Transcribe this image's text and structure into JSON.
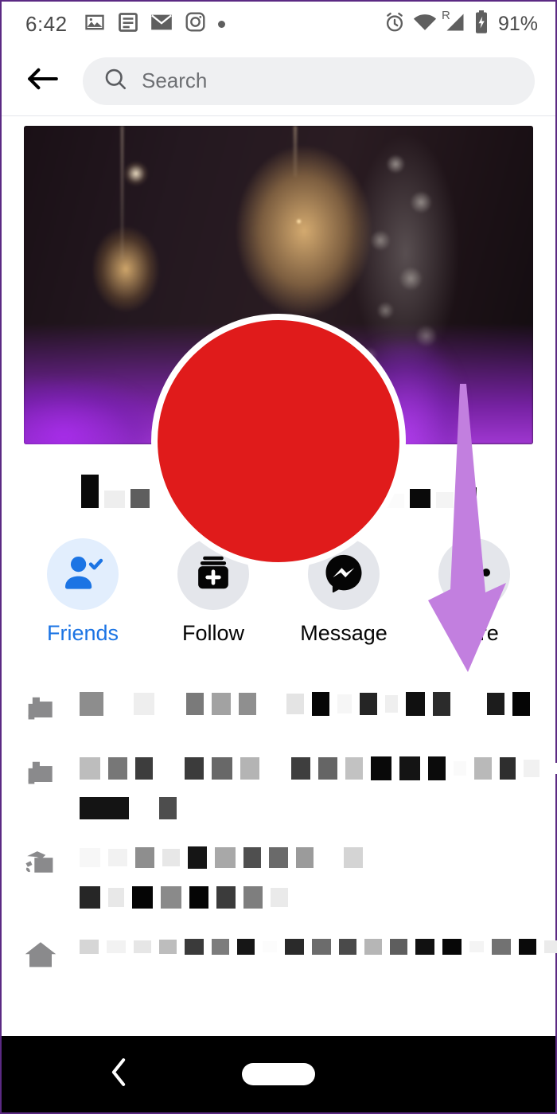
{
  "status_bar": {
    "time": "6:42",
    "left_icons": [
      "photo-icon",
      "news-icon",
      "mail-icon",
      "instagram-icon",
      "dot-icon"
    ],
    "right_icons": [
      "alarm-icon",
      "wifi-icon",
      "cellular-roaming-icon",
      "battery-charging-icon"
    ],
    "roaming_label": "R",
    "battery_percent": "91%"
  },
  "header": {
    "back_icon": "arrow-left-icon",
    "search_icon": "search-icon",
    "search_placeholder": "Search",
    "search_value": ""
  },
  "profile": {
    "cover_photo_alt": "fairy-lights-bokeh-cover-photo",
    "avatar_alt": "redacted-profile-photo",
    "avatar_color": "#e01b1b",
    "name_redacted": true,
    "name_blocks": [
      {
        "w": 22,
        "h": 42,
        "c": "#0a0a0a"
      },
      {
        "w": 26,
        "h": 22,
        "c": "#eeeeee"
      },
      {
        "w": 24,
        "h": 24,
        "c": "#5e5e5e"
      },
      {
        "w": 18,
        "h": 16,
        "c": "#ffffff"
      },
      {
        "w": 24,
        "h": 24,
        "c": "#151515"
      },
      {
        "w": 24,
        "h": 22,
        "c": "#f7f7f7"
      },
      {
        "w": 14,
        "h": 14,
        "c": "#ffffff"
      },
      {
        "w": 26,
        "h": 42,
        "c": "#1c1c1c"
      },
      {
        "w": 16,
        "h": 16,
        "c": "#ffffff"
      },
      {
        "w": 52,
        "h": 42,
        "c": "#080808"
      },
      {
        "w": 20,
        "h": 16,
        "c": "#ffffff"
      },
      {
        "w": 26,
        "h": 24,
        "c": "#8b8b8b"
      },
      {
        "w": 30,
        "h": 18,
        "c": "#fbfbfb"
      },
      {
        "w": 26,
        "h": 24,
        "c": "#0a0a0a"
      },
      {
        "w": 22,
        "h": 20,
        "c": "#f4f4f4"
      },
      {
        "w": 22,
        "h": 26,
        "c": "#0a0a0a"
      }
    ]
  },
  "actions": [
    {
      "id": "friends",
      "label": "Friends",
      "icon": "person-check-icon",
      "active": true,
      "circle_color": "#e2eefd",
      "label_color": "#1b74e4"
    },
    {
      "id": "follow",
      "label": "Follow",
      "icon": "follow-card-plus-icon",
      "active": false,
      "circle_color": "#e4e6eb",
      "label_color": "#050505"
    },
    {
      "id": "message",
      "label": "Message",
      "icon": "messenger-icon",
      "active": false,
      "circle_color": "#e4e6eb",
      "label_color": "#050505"
    },
    {
      "id": "more",
      "label": "More",
      "icon": "ellipsis-icon",
      "active": false,
      "circle_color": "#e4e6eb",
      "label_color": "#050505"
    }
  ],
  "annotation": {
    "type": "arrow",
    "direction": "down",
    "color": "#c27fdf",
    "points_to": "more-button"
  },
  "info_rows": [
    {
      "icon": "work-briefcase-icon",
      "redacted": true,
      "lines": [
        [
          {
            "w": 30,
            "h": 30,
            "c": "#8d8d8d"
          },
          {
            "w": 18,
            "h": 12,
            "c": "#ffffff"
          },
          {
            "w": 26,
            "h": 28,
            "c": "#eeeeee"
          },
          {
            "w": 20,
            "h": 14,
            "c": "#ffffff"
          },
          {
            "w": 22,
            "h": 28,
            "c": "#7a7a7a"
          },
          {
            "w": 24,
            "h": 28,
            "c": "#a2a2a2"
          },
          {
            "w": 22,
            "h": 28,
            "c": "#8f8f8f"
          },
          {
            "w": 18,
            "h": 14,
            "c": "#ffffff"
          },
          {
            "w": 22,
            "h": 26,
            "c": "#e4e4e4"
          },
          {
            "w": 22,
            "h": 30,
            "c": "#060606"
          },
          {
            "w": 18,
            "h": 24,
            "c": "#f6f6f6"
          },
          {
            "w": 22,
            "h": 28,
            "c": "#252525"
          },
          {
            "w": 16,
            "h": 22,
            "c": "#efefef"
          },
          {
            "w": 24,
            "h": 30,
            "c": "#101010"
          },
          {
            "w": 22,
            "h": 30,
            "c": "#2b2b2b"
          },
          {
            "w": 26,
            "h": 14,
            "c": "#ffffff"
          },
          {
            "w": 22,
            "h": 28,
            "c": "#1c1c1c"
          },
          {
            "w": 22,
            "h": 30,
            "c": "#050505"
          },
          {
            "w": 18,
            "h": 14,
            "c": "#ffffff"
          },
          {
            "w": 22,
            "h": 30,
            "c": "#050505"
          },
          {
            "w": 24,
            "h": 28,
            "c": "#5a5a5a"
          },
          {
            "w": 24,
            "h": 28,
            "c": "#474747"
          },
          {
            "w": 22,
            "h": 28,
            "c": "#3a3a3a"
          },
          {
            "w": 18,
            "h": 14,
            "c": "#fafafa"
          },
          {
            "w": 24,
            "h": 28,
            "c": "#0a0a0a"
          }
        ]
      ]
    },
    {
      "icon": "work-briefcase-icon",
      "redacted": true,
      "lines": [
        [
          {
            "w": 26,
            "h": 28,
            "c": "#bdbdbd"
          },
          {
            "w": 24,
            "h": 28,
            "c": "#777777"
          },
          {
            "w": 22,
            "h": 28,
            "c": "#3d3d3d"
          },
          {
            "w": 20,
            "h": 14,
            "c": "#ffffff"
          },
          {
            "w": 24,
            "h": 28,
            "c": "#3b3b3b"
          },
          {
            "w": 26,
            "h": 28,
            "c": "#686868"
          },
          {
            "w": 24,
            "h": 28,
            "c": "#b4b4b4"
          },
          {
            "w": 20,
            "h": 14,
            "c": "#ffffff"
          },
          {
            "w": 24,
            "h": 28,
            "c": "#3e3e3e"
          },
          {
            "w": 24,
            "h": 28,
            "c": "#656565"
          },
          {
            "w": 22,
            "h": 28,
            "c": "#c2c2c2"
          },
          {
            "w": 26,
            "h": 30,
            "c": "#090909"
          },
          {
            "w": 26,
            "h": 30,
            "c": "#141414"
          },
          {
            "w": 22,
            "h": 30,
            "c": "#0b0b0b"
          },
          {
            "w": 16,
            "h": 18,
            "c": "#fafafa"
          },
          {
            "w": 22,
            "h": 28,
            "c": "#b9b9b9"
          },
          {
            "w": 20,
            "h": 28,
            "c": "#2e2e2e"
          },
          {
            "w": 20,
            "h": 22,
            "c": "#f1f1f1"
          },
          {
            "w": 18,
            "h": 14,
            "c": "#ffffff"
          },
          {
            "w": 40,
            "h": 28,
            "c": "#0d0d0d"
          }
        ],
        [
          {
            "w": 62,
            "h": 28,
            "c": "#141414"
          },
          {
            "w": 18,
            "h": 14,
            "c": "#ffffff"
          },
          {
            "w": 22,
            "h": 28,
            "c": "#4d4d4d"
          }
        ]
      ]
    },
    {
      "icon": "education-cap-icon",
      "redacted": true,
      "lines": [
        [
          {
            "w": 26,
            "h": 24,
            "c": "#f7f7f7"
          },
          {
            "w": 24,
            "h": 22,
            "c": "#f2f2f2"
          },
          {
            "w": 24,
            "h": 26,
            "c": "#8e8e8e"
          },
          {
            "w": 22,
            "h": 22,
            "c": "#e7e7e7"
          },
          {
            "w": 24,
            "h": 28,
            "c": "#151515"
          },
          {
            "w": 26,
            "h": 26,
            "c": "#a8a8a8"
          },
          {
            "w": 22,
            "h": 26,
            "c": "#4f4f4f"
          },
          {
            "w": 24,
            "h": 26,
            "c": "#6a6a6a"
          },
          {
            "w": 22,
            "h": 26,
            "c": "#9b9b9b"
          },
          {
            "w": 18,
            "h": 14,
            "c": "#ffffff"
          },
          {
            "w": 24,
            "h": 26,
            "c": "#d4d4d4"
          }
        ],
        [
          {
            "w": 26,
            "h": 28,
            "c": "#262626"
          },
          {
            "w": 20,
            "h": 24,
            "c": "#e8e8e8"
          },
          {
            "w": 26,
            "h": 28,
            "c": "#050505"
          },
          {
            "w": 26,
            "h": 28,
            "c": "#8a8a8a"
          },
          {
            "w": 24,
            "h": 28,
            "c": "#050505"
          },
          {
            "w": 24,
            "h": 28,
            "c": "#3b3b3b"
          },
          {
            "w": 24,
            "h": 28,
            "c": "#7e7e7e"
          },
          {
            "w": 22,
            "h": 24,
            "c": "#eaeaea"
          }
        ]
      ]
    },
    {
      "icon": "home-icon",
      "redacted": true,
      "lines": [
        [
          {
            "w": 24,
            "h": 18,
            "c": "#d6d6d6"
          },
          {
            "w": 24,
            "h": 16,
            "c": "#f2f2f2"
          },
          {
            "w": 22,
            "h": 16,
            "c": "#e6e6e6"
          },
          {
            "w": 22,
            "h": 18,
            "c": "#bdbdbd"
          },
          {
            "w": 24,
            "h": 20,
            "c": "#3a3a3a"
          },
          {
            "w": 22,
            "h": 20,
            "c": "#7c7c7c"
          },
          {
            "w": 22,
            "h": 20,
            "c": "#161616"
          },
          {
            "w": 18,
            "h": 14,
            "c": "#fcfcfc"
          },
          {
            "w": 24,
            "h": 20,
            "c": "#2a2a2a"
          },
          {
            "w": 24,
            "h": 20,
            "c": "#6c6c6c"
          },
          {
            "w": 22,
            "h": 20,
            "c": "#4a4a4a"
          },
          {
            "w": 22,
            "h": 20,
            "c": "#b6b6b6"
          },
          {
            "w": 22,
            "h": 20,
            "c": "#5e5e5e"
          },
          {
            "w": 24,
            "h": 20,
            "c": "#111111"
          },
          {
            "w": 24,
            "h": 20,
            "c": "#070707"
          },
          {
            "w": 18,
            "h": 14,
            "c": "#f4f4f4"
          },
          {
            "w": 24,
            "h": 20,
            "c": "#727272"
          },
          {
            "w": 22,
            "h": 20,
            "c": "#0a0a0a"
          },
          {
            "w": 20,
            "h": 16,
            "c": "#ebebeb"
          },
          {
            "w": 24,
            "h": 20,
            "c": "#101010"
          },
          {
            "w": 24,
            "h": 20,
            "c": "#0a0a0a"
          },
          {
            "w": 18,
            "h": 14,
            "c": "#f6f6f6"
          },
          {
            "w": 22,
            "h": 20,
            "c": "#313131"
          },
          {
            "w": 18,
            "h": 14,
            "c": "#fafafa"
          },
          {
            "w": 24,
            "h": 20,
            "c": "#242424"
          },
          {
            "w": 24,
            "h": 20,
            "c": "#8c8c8c"
          },
          {
            "w": 22,
            "h": 20,
            "c": "#9a9a9a"
          }
        ]
      ]
    }
  ],
  "nav_bar": {
    "back_icon": "chevron-back-icon",
    "home_icon": "home-pill-icon"
  }
}
